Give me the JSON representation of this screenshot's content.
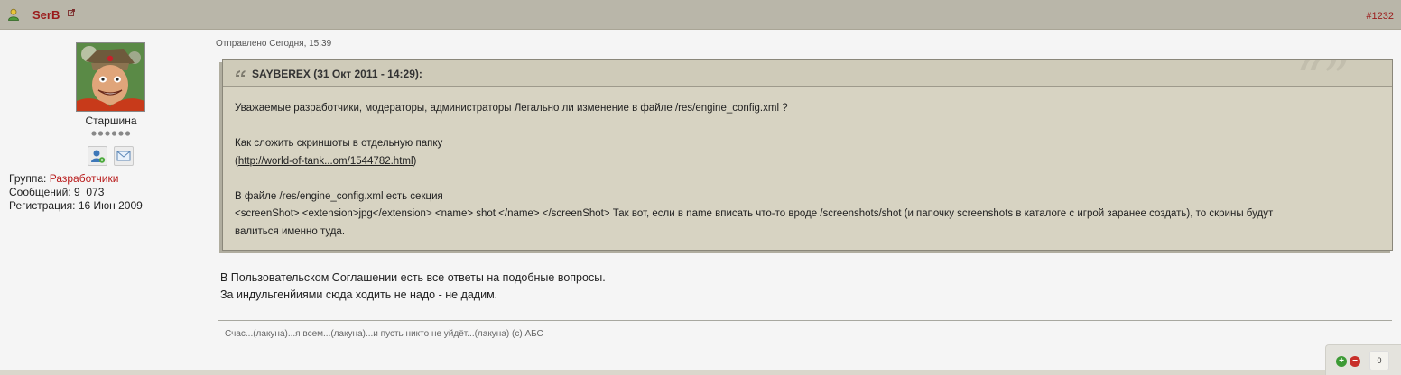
{
  "post": {
    "author": "SerB",
    "number": "#1232",
    "sent": "Отправлено Сегодня, 15:39"
  },
  "profile": {
    "rank": "Старшина",
    "group_label": "Группа:",
    "group_value": "Разработчики",
    "messages_label": "Сообщений:",
    "messages_value": "9  073",
    "registration_label": "Регистрация:",
    "registration_value": "16 Июн 2009"
  },
  "quote": {
    "author_line": "SAYBEREX (31 Окт 2011 - 14:29):",
    "line1": "Уважаемые разработчики, модераторы, администраторы Легально ли изменение в файле /res/engine_config.xml ?",
    "line2": "Как сложить скриншоты в отдельную папку",
    "link_open": "(",
    "link_text": "http://world-of-tank...om/1544782.html",
    "link_close": ")",
    "line3": "В файле /res/engine_config.xml есть секция",
    "line4": "<screenShot> <extension>jpg</extension> <name> shot </name> </screenShot> Так вот, если в name вписать что-то вроде /screenshots/shot (и папочку screenshots в каталоге с игрой заранее создать), то скрины будут",
    "line5": "валиться именно туда."
  },
  "reply": {
    "line1": "В Пользовательском Соглашении есть все ответы на подобные вопросы.",
    "line2": "За индульгенйиями сюда ходить не надо - не дадим."
  },
  "signature": "Счас...(лакуна)...я всем...(лакуна)...и пусть никто не уйдёт...(лакуна) (с) АБС",
  "reputation": {
    "count": "0"
  },
  "colors": {
    "header_bg": "#b9b6a9",
    "author": "#9b1b1b",
    "quote_bg": "#d7d3c2",
    "group_red": "#b91d1d"
  },
  "icons": {
    "user": "user-icon",
    "external_link": "external-link-icon",
    "quote": "quote-icon",
    "profile": "profile-icon",
    "message": "message-icon",
    "plus": "plus-icon",
    "minus": "minus-icon"
  }
}
